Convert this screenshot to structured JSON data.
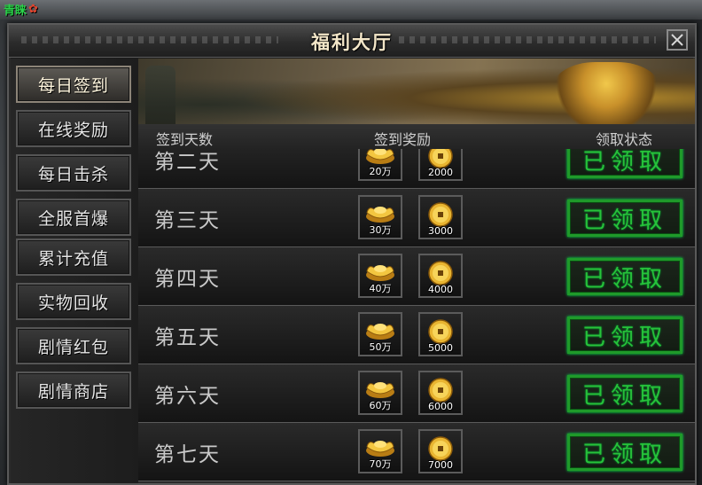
{
  "corner": {
    "badge_text": "青睐"
  },
  "window": {
    "title": "福利大厅"
  },
  "sidebar": {
    "items": [
      {
        "label": "每日签到",
        "active": true
      },
      {
        "label": "在线奖励",
        "active": false
      },
      {
        "label": "每日击杀",
        "active": false
      },
      {
        "label": "全服首爆",
        "active": false
      },
      {
        "label": "累计充值",
        "active": false
      },
      {
        "label": "实物回收",
        "active": false
      },
      {
        "label": "剧情红包",
        "active": false
      },
      {
        "label": "剧情商店",
        "active": false
      }
    ]
  },
  "table": {
    "headers": {
      "day": "签到天数",
      "reward": "签到奖励",
      "status": "领取状态"
    },
    "rows": [
      {
        "day": "第二天",
        "ingot_amount": "20万",
        "coin_amount": "2000",
        "status": "已领取"
      },
      {
        "day": "第三天",
        "ingot_amount": "30万",
        "coin_amount": "3000",
        "status": "已领取"
      },
      {
        "day": "第四天",
        "ingot_amount": "40万",
        "coin_amount": "4000",
        "status": "已领取"
      },
      {
        "day": "第五天",
        "ingot_amount": "50万",
        "coin_amount": "5000",
        "status": "已领取"
      },
      {
        "day": "第六天",
        "ingot_amount": "60万",
        "coin_amount": "6000",
        "status": "已领取"
      },
      {
        "day": "第七天",
        "ingot_amount": "70万",
        "coin_amount": "7000",
        "status": "已领取"
      }
    ]
  },
  "icons": {
    "close": "close-icon",
    "ingot": "gold-ingot-icon",
    "coin": "gold-coin-icon"
  },
  "colors": {
    "claimed_green": "#27c23a",
    "title_text": "#f3e6c8",
    "gold": "#f1c84b"
  }
}
